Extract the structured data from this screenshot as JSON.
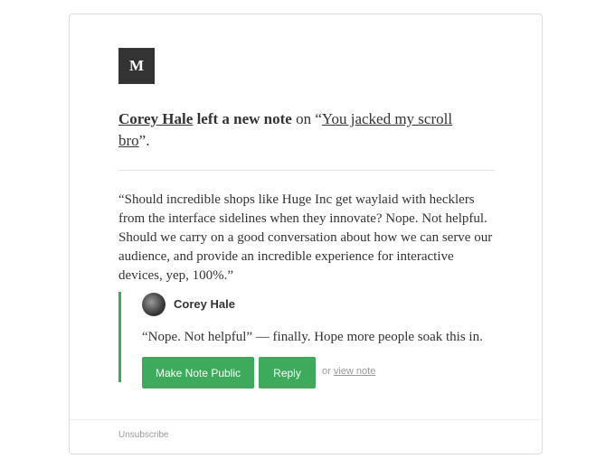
{
  "logo": {
    "letter": "M"
  },
  "headline": {
    "author": "Corey Hale",
    "action": " left a new note",
    "on": " on “",
    "post_title_line1": "You jacked my scroll",
    "post_title_line2": "bro",
    "end": "”."
  },
  "quote": "“Should incredible shops like Huge Inc get waylaid with hecklers from the interface sidelines when they innovate? Nope. Not helpful. Should we carry on a good conversation about how we can serve our audience, and provide an incredible experience for interactive devices, yep, 100%.”",
  "note": {
    "author": "Corey Hale",
    "text": "“Nope. Not helpful” — finally. Hope more people soak this in.",
    "make_public_label": "Make Note Public",
    "reply_label": "Reply",
    "or_text": "or ",
    "view_note_label": "view note",
    "accent_color": "#3daa5c"
  },
  "footer": {
    "unsubscribe_label": "Unsubscribe"
  }
}
